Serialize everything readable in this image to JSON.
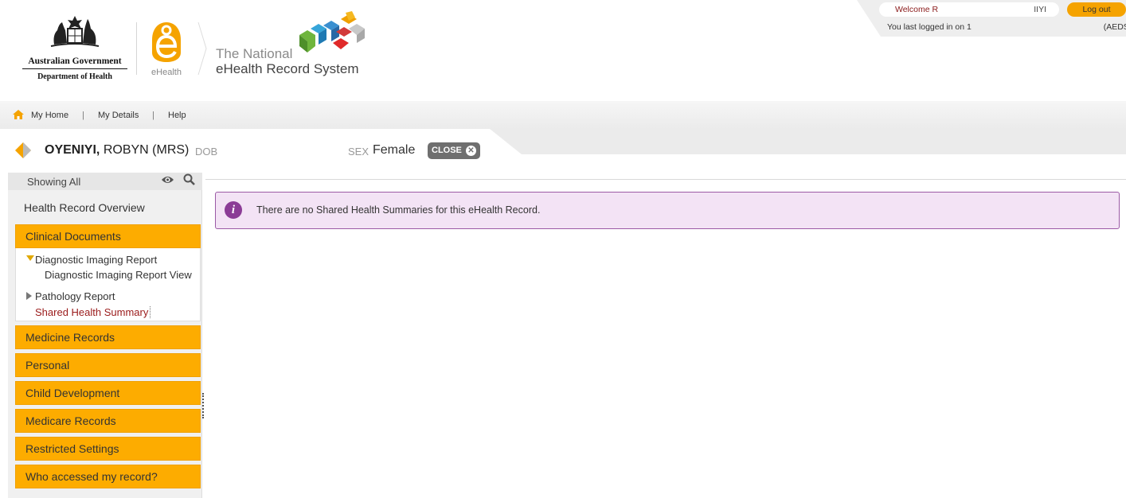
{
  "header": {
    "gov_line1": "Australian Government",
    "gov_line2": "Department of Health",
    "ehealth_label": "eHealth",
    "title_line1": "The National",
    "title_line2": "eHealth Record System"
  },
  "user_panel": {
    "welcome_prefix": "Welcome R",
    "welcome_suffix": "IIYI",
    "logout_label": "Log out",
    "last_login_prefix": "You last logged in on 1",
    "last_login_suffix": "(AEDST)"
  },
  "nav": {
    "items": [
      "My Home",
      "My Details",
      "Help"
    ],
    "separator": "|"
  },
  "patient": {
    "surname": "OYENIYI,",
    "given": "ROBYN (MRS)",
    "dob_label": "DOB",
    "sex_label": "SEX",
    "sex_value": "Female",
    "close_label": "CLOSE",
    "close_glyph": "✕"
  },
  "sidebar": {
    "showing_label": "Showing  All",
    "overview_label": "Health Record Overview",
    "clinical_documents": "Clinical Documents",
    "sub_items": {
      "diagnostic_imaging": "Diagnostic Imaging Report",
      "diagnostic_imaging_view": "Diagnostic Imaging Report View",
      "pathology": "Pathology Report",
      "shared_health_summary": "Shared Health Summary"
    },
    "sections": [
      "Medicine Records",
      "Personal",
      "Child Development",
      "Medicare Records",
      "Restricted Settings",
      "Who accessed my record?"
    ]
  },
  "main": {
    "info_glyph": "i",
    "info_message": "There are no Shared Health Summaries for this eHealth Record."
  },
  "colors": {
    "accent_orange": "#fdac00",
    "info_purple": "#8b3c96",
    "info_bg": "#f3e3f5"
  }
}
